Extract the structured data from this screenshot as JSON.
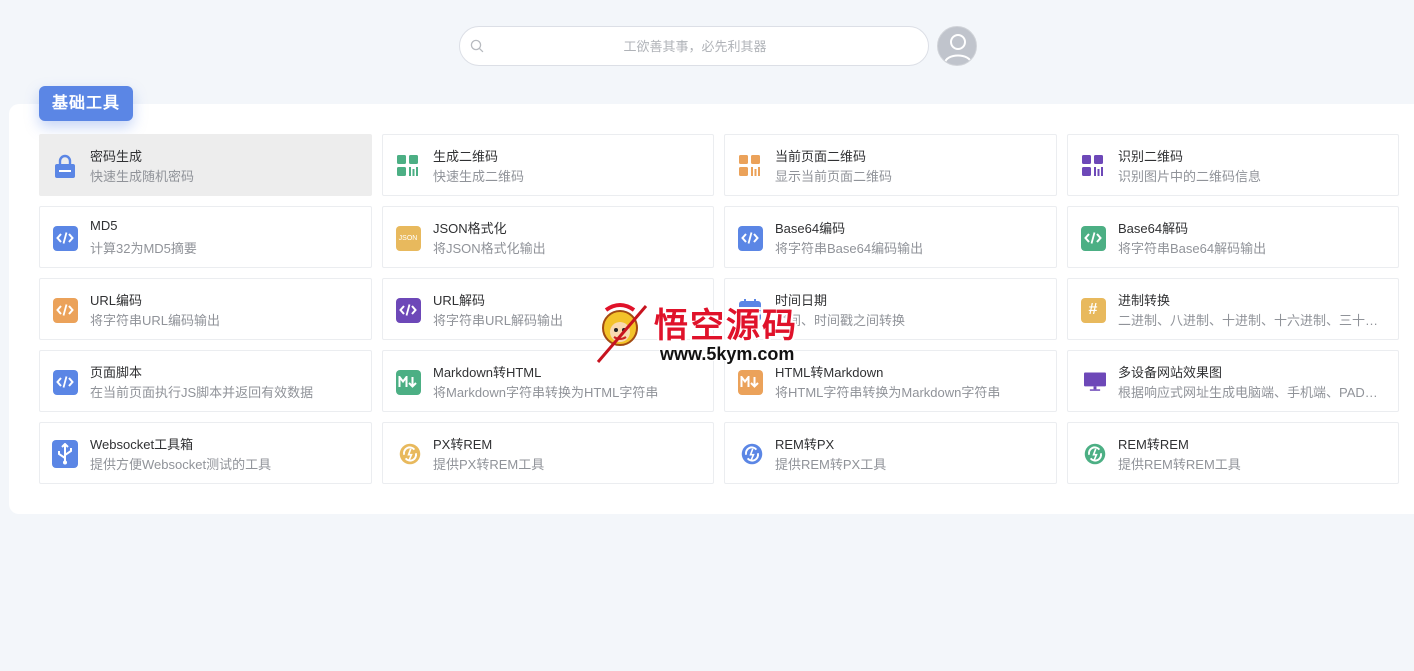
{
  "search": {
    "placeholder": "工欲善其事，必先利其器",
    "value": ""
  },
  "section": {
    "title": "基础工具"
  },
  "colors": {
    "blue": "#5b86e5",
    "green": "#4caf84",
    "orange": "#eba25a",
    "purple": "#6d48b8",
    "yellow": "#e8b95d",
    "bg": "#f3f6fa"
  },
  "tools": [
    {
      "title": "密码生成",
      "desc": "快速生成随机密码",
      "icon": "lock-icon",
      "color": "#5b86e5"
    },
    {
      "title": "生成二维码",
      "desc": "快速生成二维码",
      "icon": "qrcode-icon",
      "color": "#4caf84"
    },
    {
      "title": "当前页面二维码",
      "desc": "显示当前页面二维码",
      "icon": "qrcode-icon",
      "color": "#eba25a"
    },
    {
      "title": "识别二维码",
      "desc": "识别图片中的二维码信息",
      "icon": "qrcode-icon",
      "color": "#6d48b8"
    },
    {
      "title": "MD5",
      "desc": "计算32为MD5摘要",
      "icon": "code-icon",
      "color": "#5b86e5"
    },
    {
      "title": "JSON格式化",
      "desc": "将JSON格式化输出",
      "icon": "json-icon",
      "color": "#e8b95d"
    },
    {
      "title": "Base64编码",
      "desc": "将字符串Base64编码输出",
      "icon": "code-icon",
      "color": "#5b86e5"
    },
    {
      "title": "Base64解码",
      "desc": "将字符串Base64解码输出",
      "icon": "code-icon",
      "color": "#4caf84"
    },
    {
      "title": "URL编码",
      "desc": "将字符串URL编码输出",
      "icon": "code-icon",
      "color": "#eba25a"
    },
    {
      "title": "URL解码",
      "desc": "将字符串URL解码输出",
      "icon": "code-icon",
      "color": "#6d48b8"
    },
    {
      "title": "时间日期",
      "desc": "时间、时间戳之间转换",
      "icon": "calendar-icon",
      "color": "#5b86e5"
    },
    {
      "title": "进制转换",
      "desc": "二进制、八进制、十进制、十六进制、三十二进制",
      "icon": "hash-icon",
      "color": "#e8b95d"
    },
    {
      "title": "页面脚本",
      "desc": "在当前页面执行JS脚本并返回有效数据",
      "icon": "code-icon",
      "color": "#5b86e5"
    },
    {
      "title": "Markdown转HTML",
      "desc": "将Markdown字符串转换为HTML字符串",
      "icon": "markdown-icon",
      "color": "#4caf84"
    },
    {
      "title": "HTML转Markdown",
      "desc": "将HTML字符串转换为Markdown字符串",
      "icon": "markdown-icon",
      "color": "#eba25a"
    },
    {
      "title": "多设备网站效果图",
      "desc": "根据响应式网址生成电脑端、手机端、PAD端效果图",
      "icon": "monitor-icon",
      "color": "#6d48b8"
    },
    {
      "title": "Websocket工具箱",
      "desc": "提供方便Websocket测试的工具",
      "icon": "usb-icon",
      "color": "#5b86e5"
    },
    {
      "title": "PX转REM",
      "desc": "提供PX转REM工具",
      "icon": "convert-icon",
      "color": "#e8b95d"
    },
    {
      "title": "REM转PX",
      "desc": "提供REM转PX工具",
      "icon": "convert-icon",
      "color": "#5b86e5"
    },
    {
      "title": "REM转REM",
      "desc": "提供REM转REM工具",
      "icon": "convert-icon",
      "color": "#4caf84"
    }
  ],
  "watermark": {
    "title": "悟空源码",
    "url": "www.5kym.com"
  }
}
